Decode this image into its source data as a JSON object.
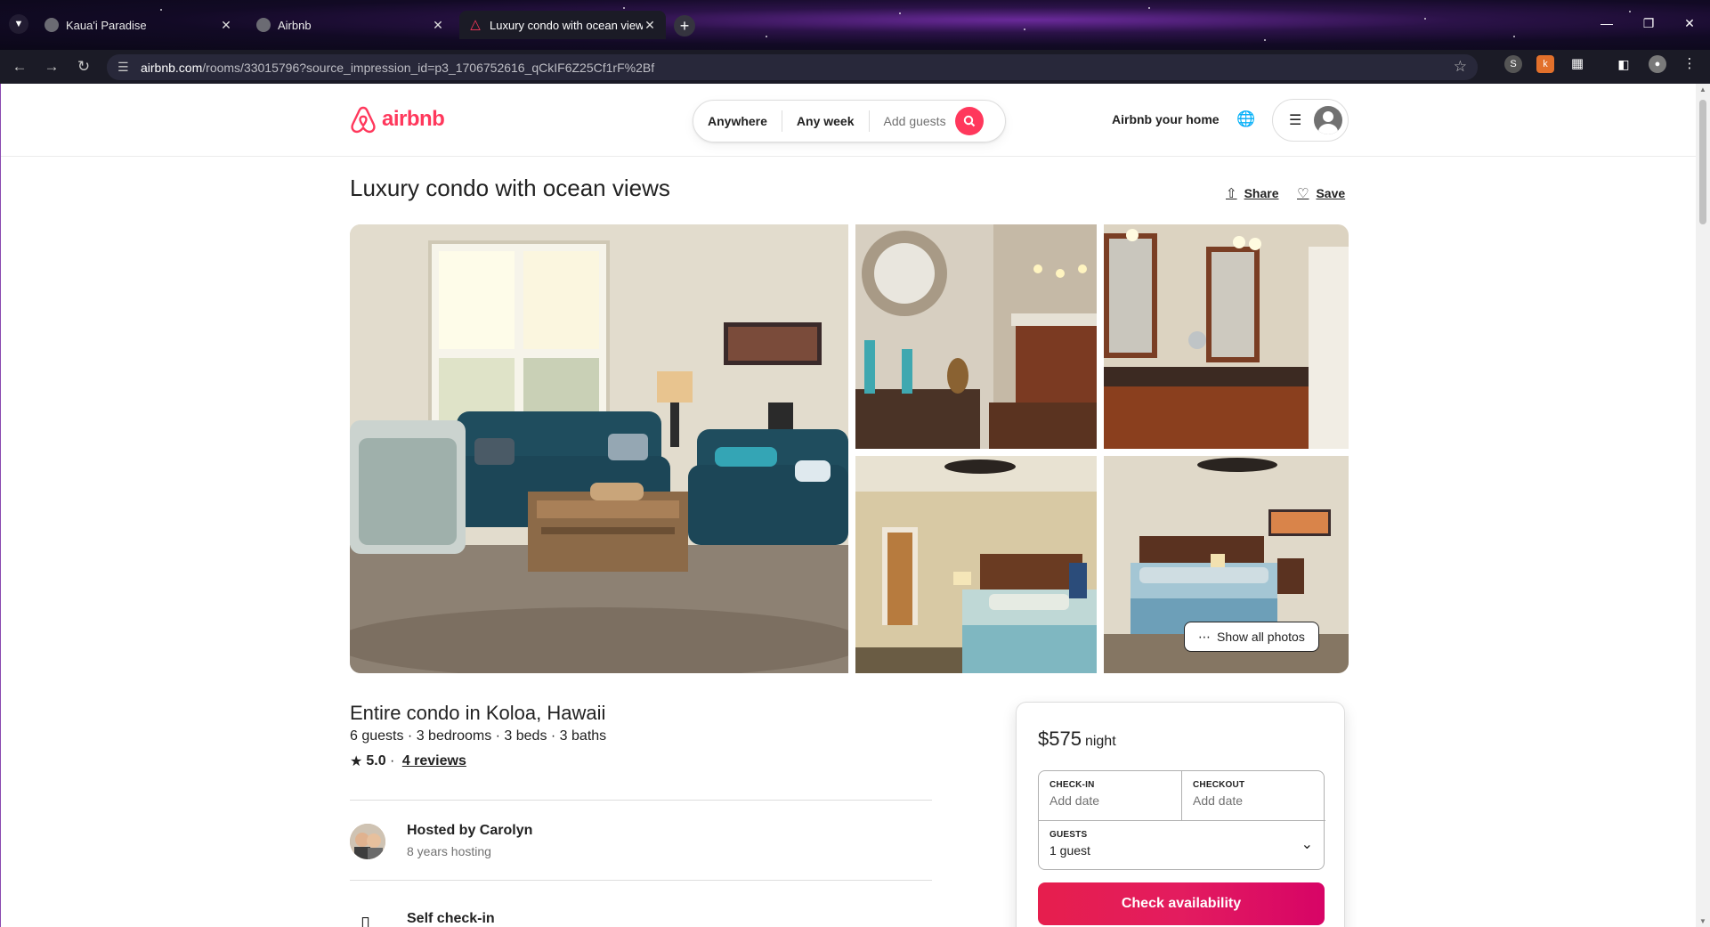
{
  "browser": {
    "tabs": [
      {
        "label": "Kaua'i Paradise",
        "active": false
      },
      {
        "label": "Airbnb",
        "active": false
      },
      {
        "label": "Luxury condo with ocean views",
        "active": true
      }
    ],
    "url_host": "airbnb.com",
    "url_path": "/rooms/33015796?source_impression_id=p3_1706752616_qCkIF6Z25Cf1rF%2Bf"
  },
  "header": {
    "brand": "airbnb",
    "search": {
      "anywhere": "Anywhere",
      "any_week": "Any week",
      "add_guests": "Add guests"
    },
    "host_link": "Airbnb your home"
  },
  "listing": {
    "title": "Luxury condo with ocean views",
    "share_label": "Share",
    "save_label": "Save",
    "show_all_photos": "Show all photos",
    "place_type": "Entire condo in Koloa, Hawaii",
    "facts": "6 guests · 3 bedrooms · 3 beds · 3 baths",
    "rating": "5.0",
    "rating_sep": " · ",
    "reviews": "4 reviews",
    "hosted_by": "Hosted by Carolyn",
    "hosting_years": "8 years hosting",
    "self_checkin": "Self check-in"
  },
  "booking": {
    "price": "$575",
    "per": "night",
    "checkin_label": "CHECK-IN",
    "checkin_value": "Add date",
    "checkout_label": "CHECKOUT",
    "checkout_value": "Add date",
    "guests_label": "GUESTS",
    "guests_value": "1 guest",
    "cta": "Check availability"
  },
  "colors": {
    "brand": "#ff385c",
    "cta": "#e31c5f"
  }
}
